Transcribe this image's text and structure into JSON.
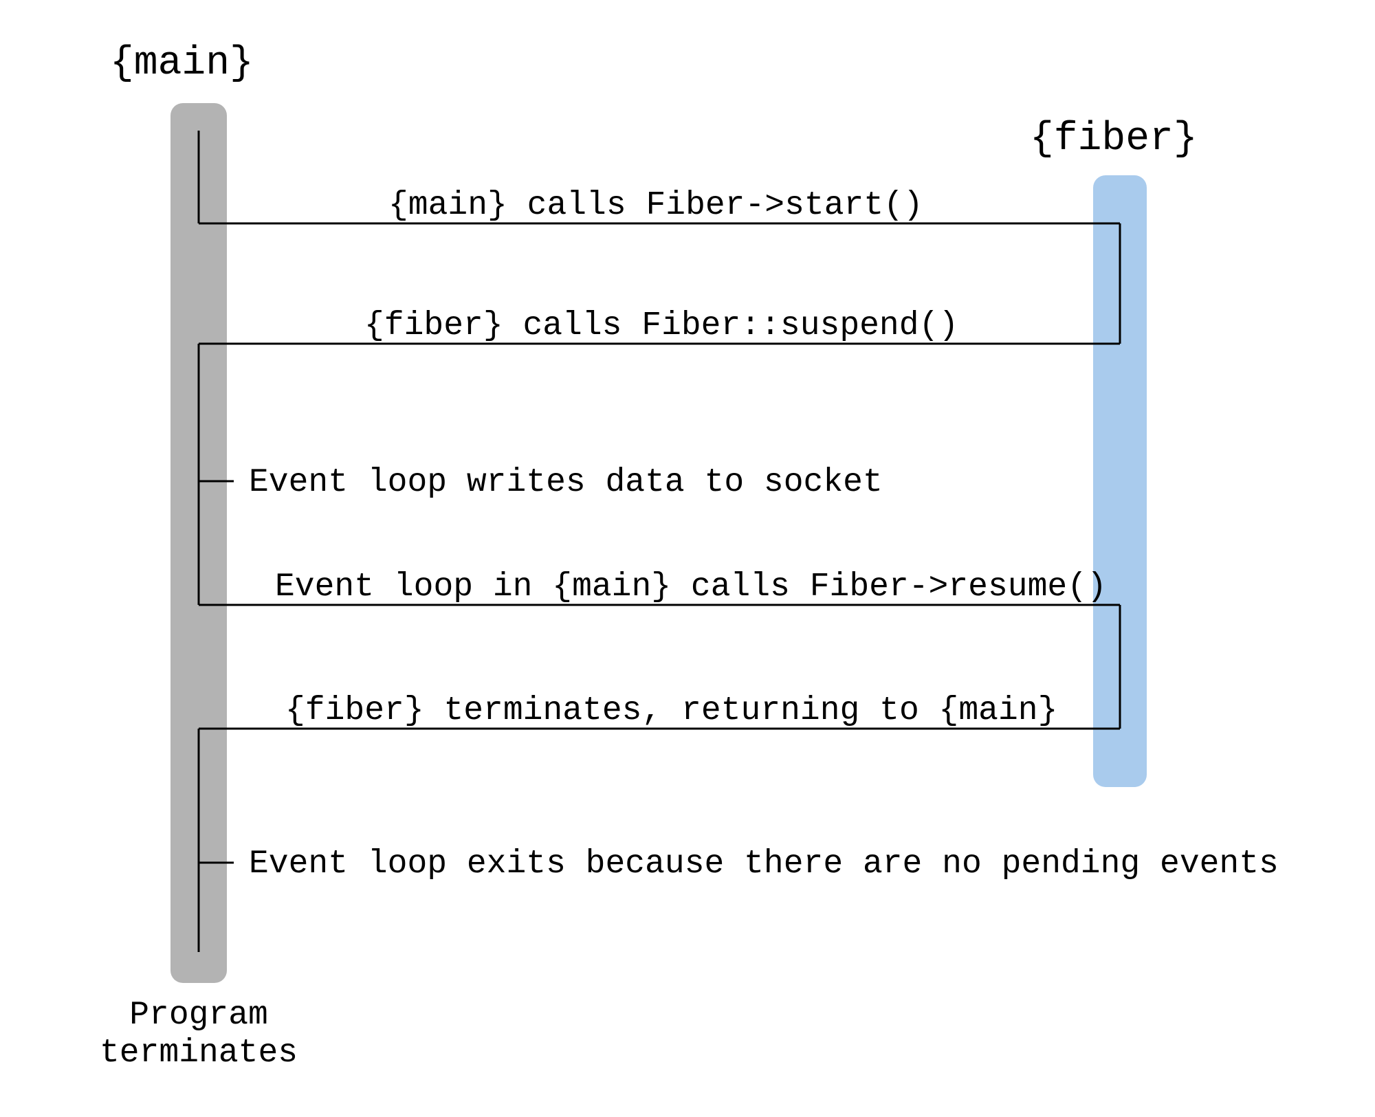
{
  "participants": {
    "main": "{main}",
    "fiber": "{fiber}"
  },
  "messages": {
    "m1": "{main} calls Fiber->start()",
    "m2": "{fiber} calls Fiber::suspend()",
    "m3": "Event loop writes data to socket",
    "m4": "Event loop in {main} calls Fiber->resume()",
    "m5": "{fiber} terminates, returning to {main}",
    "m6": "Event loop exits because there are no pending events"
  },
  "end_label": "Program\nterminates",
  "colors": {
    "main_bar": "#b3b3b3",
    "fiber_bar": "#a9cbed",
    "line": "#000000"
  }
}
